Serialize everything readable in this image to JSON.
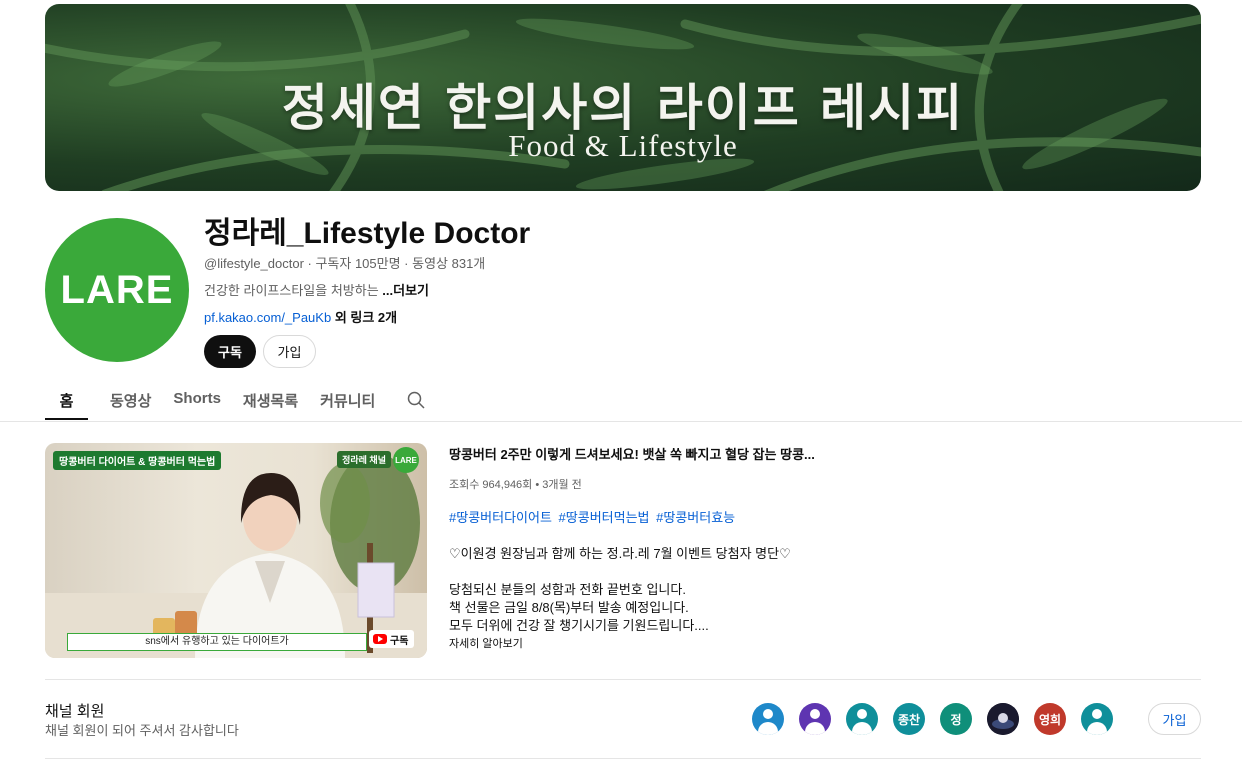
{
  "banner": {
    "title": "정세연 한의사의 라이프 레시피",
    "subtitle": "Food & Lifestyle"
  },
  "channel": {
    "avatar_text": "LARE",
    "name": "정라레_Lifestyle Doctor",
    "meta": "@lifestyle_doctor · 구독자 105만명 · 동영상 831개",
    "description": "건강한 라이프스타일을 처방하는",
    "more_label": "...더보기",
    "link_text": "pf.kakao.com/_PauKb",
    "link_extra": "외 링크 2개",
    "subscribe_label": "구독",
    "join_label": "가입"
  },
  "tabs": [
    {
      "label": "홈",
      "active": true
    },
    {
      "label": "동영상"
    },
    {
      "label": "Shorts"
    },
    {
      "label": "재생목록"
    },
    {
      "label": "커뮤니티"
    }
  ],
  "featured": {
    "thumb_tag": "땅콩버터 다이어트 & 땅콩버터 먹는법",
    "thumb_channel": "정라레 채널",
    "thumb_logo": "LARE",
    "thumb_caption": "sns에서 유행하고 있는 다이어트가",
    "thumb_sub": "구독",
    "title": "땅콩버터 2주만 이렇게 드셔보세요! 뱃살 쏙 빠지고 혈당 잡는 땅콩...",
    "meta": "조회수 964,946회 • 3개월 전",
    "tags": [
      "#땅콩버터다이어트",
      "#땅콩버터먹는법",
      "#땅콩버터효능"
    ],
    "line1": "♡이원경 원장님과 함께 하는 정.라.레 7월 이벤트 당첨자 명단♡",
    "line2": "당첨되신 분들의 성함과 전화 끝번호 입니다.",
    "line3": "책 선물은 금일 8/8(목)부터 발송 예정입니다.",
    "line4": "모두 더위에 건강 잘 챙기시기를 기원드립니다....",
    "more": "자세히 알아보기"
  },
  "membership": {
    "title": "채널 회원",
    "subtitle": "채널 회원이 되어 주셔서 감사합니다",
    "join_label": "가입",
    "members": [
      {
        "type": "icon",
        "color": "#1e88c9"
      },
      {
        "type": "icon",
        "color": "#5e35b1"
      },
      {
        "type": "icon",
        "color": "#0f8f9a"
      },
      {
        "type": "text",
        "text": "종찬",
        "color": "#0f8f9a"
      },
      {
        "type": "text",
        "text": "정",
        "color": "#0f8f7a"
      },
      {
        "type": "image",
        "color": "#1a1a2e"
      },
      {
        "type": "text",
        "text": "영희",
        "color": "#c0392b"
      },
      {
        "type": "icon",
        "color": "#0f8f9a"
      }
    ]
  }
}
